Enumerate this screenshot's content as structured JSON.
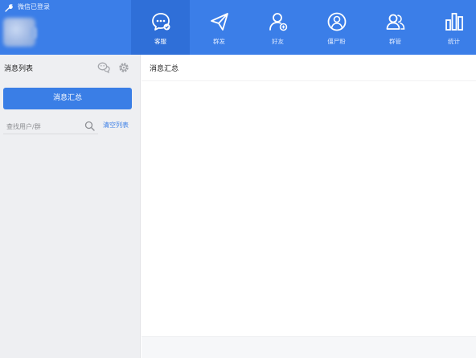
{
  "header": {
    "brand_status": "微信已登录",
    "nav": [
      {
        "label": "客服",
        "icon": "chat-bubble-icon",
        "active": true
      },
      {
        "label": "群发",
        "icon": "paper-plane-icon",
        "active": false
      },
      {
        "label": "好友",
        "icon": "user-add-icon",
        "active": false
      },
      {
        "label": "僵尸粉",
        "icon": "user-circle-icon",
        "active": false
      },
      {
        "label": "群管",
        "icon": "user-group-icon",
        "active": false
      },
      {
        "label": "统计",
        "icon": "bar-chart-icon",
        "active": false
      }
    ]
  },
  "sidebar": {
    "title": "消息列表",
    "summary_button": "消息汇总",
    "search": {
      "value": "",
      "placeholder": "查找用户/群"
    },
    "clear_link": "清空列表"
  },
  "main": {
    "title": "消息汇总"
  },
  "colors": {
    "header_bg": "#3b7ee8",
    "active_tab_bg": "#2f6fd8",
    "primary_button": "#3a7ee6",
    "sidebar_bg": "#eeeff2"
  }
}
